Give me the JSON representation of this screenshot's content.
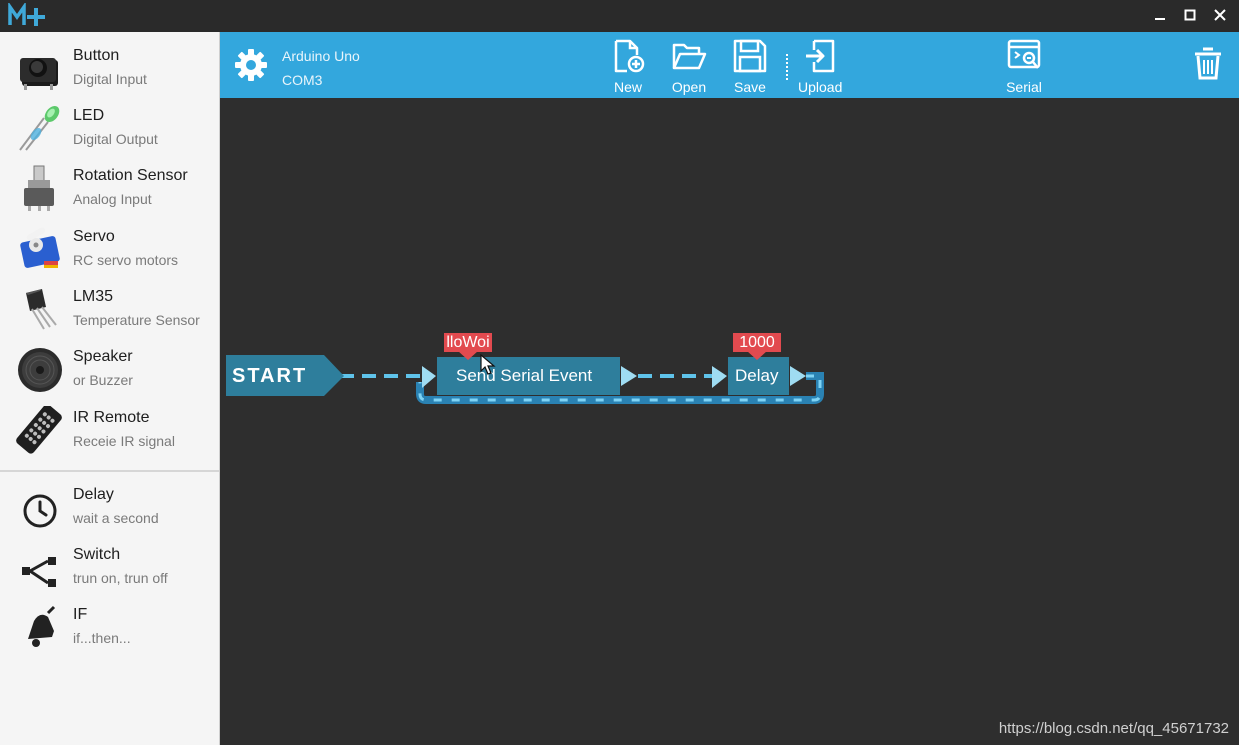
{
  "app": {
    "logo_text": "M+"
  },
  "window_controls": [
    "minimize",
    "maximize",
    "close"
  ],
  "sidebar": {
    "components": [
      {
        "name": "Button",
        "desc": "Digital Input",
        "icon": "push-button-icon"
      },
      {
        "name": "LED",
        "desc": "Digital Output",
        "icon": "led-icon"
      },
      {
        "name": "Rotation Sensor",
        "desc": "Analog Input",
        "icon": "potentiometer-icon"
      },
      {
        "name": "Servo",
        "desc": "RC servo motors",
        "icon": "servo-icon"
      },
      {
        "name": "LM35",
        "desc": "Temperature Sensor",
        "icon": "lm35-icon"
      },
      {
        "name": "Speaker",
        "desc": "or Buzzer",
        "icon": "speaker-icon"
      },
      {
        "name": "IR Remote",
        "desc": "Receie IR signal",
        "icon": "ir-remote-icon"
      }
    ],
    "logic": [
      {
        "name": "Delay",
        "desc": "wait a second",
        "icon": "clock-icon"
      },
      {
        "name": "Switch",
        "desc": "trun on, trun off",
        "icon": "switch-branch-icon"
      },
      {
        "name": "IF",
        "desc": "if...then...",
        "icon": "bell-icon"
      }
    ]
  },
  "toolbar": {
    "board": "Arduino Uno",
    "port": "COM3",
    "new_label": "New",
    "open_label": "Open",
    "save_label": "Save",
    "upload_label": "Upload",
    "serial_label": "Serial"
  },
  "canvas": {
    "start_label": "START",
    "blocks": [
      {
        "label": "Send Serial Event",
        "param": "lloWoi"
      },
      {
        "label": "Delay",
        "param": "1000"
      }
    ]
  },
  "watermark": "https://blog.csdn.net/qq_45671732",
  "colors": {
    "toolbar": "#33a7dd",
    "block": "#2e7e9c",
    "param_tag": "#e24a4f",
    "canvas": "#2e2e2e",
    "sidebar": "#f5f5f5"
  }
}
